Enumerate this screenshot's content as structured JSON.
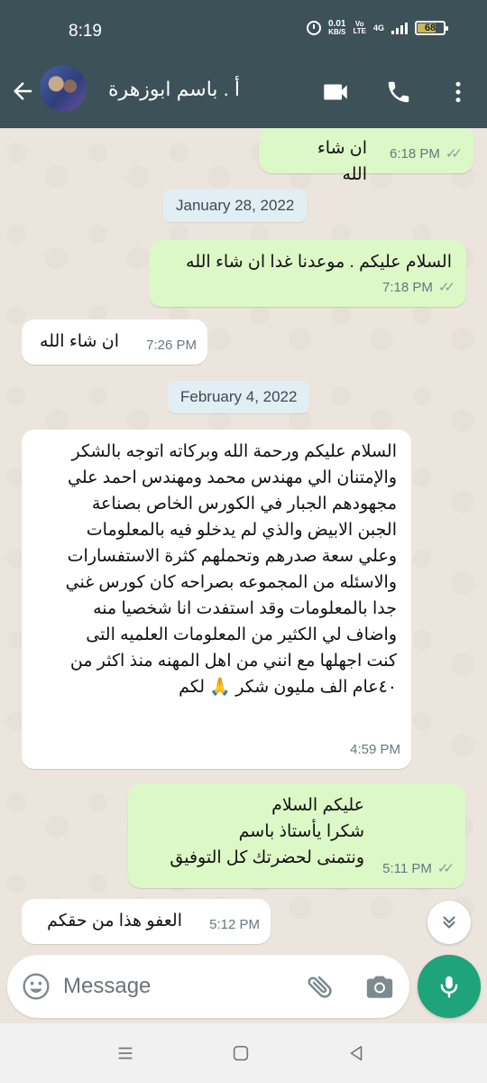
{
  "status_bar": {
    "time": "8:19",
    "speed_value": "0.01",
    "speed_unit": "KB/S",
    "volte_top": "Vo",
    "volte_bottom": "LTE",
    "network_type": "4G",
    "battery_level": "68"
  },
  "header": {
    "contact_name": "أ . باسم ابوزهرة",
    "bar_color": "#3d5159"
  },
  "messages": [
    {
      "direction": "out",
      "text": "ان شاء الله",
      "time": "6:18 PM",
      "read": true
    },
    {
      "type": "date",
      "text": "January 28, 2022"
    },
    {
      "direction": "out",
      "text": "السلام عليكم . موعدنا غدا ان شاء الله",
      "time": "7:18 PM",
      "read": true
    },
    {
      "direction": "in",
      "text": "ان شاء الله",
      "time": "7:26 PM"
    },
    {
      "type": "date",
      "text": "February 4, 2022"
    },
    {
      "direction": "in",
      "lines": [
        "السلام عليكم ورحمة الله وبركاته اتوجه بالشكر",
        "والإمتنان الي مهندس محمد ومهندس احمد علي",
        "مجهودهم الجبار في الكورس الخاص بصناعة",
        "الجبن الابيض والذي لم يدخلو فيه بالمعلومات",
        "وعلي سعة صدرهم وتحملهم كثرة الاستفسارات",
        "والاسئله من المجموعه بصراحه كان كورس غني",
        "جدا بالمعلومات وقد استفدت انا شخصيا منه",
        "واضاف لي الكثير من المعلومات العلميه التى",
        "كنت اجهلها مع انني من اهل المهنه منذ اكثر من",
        "٤٠عام الف مليون شكر 🙏 لكم"
      ],
      "time": "4:59 PM"
    },
    {
      "direction": "out",
      "lines": [
        "عليكم السلام",
        "شكرا يأستاذ باسم",
        "ونتمنى لحضرتك كل التوفيق"
      ],
      "time": "5:11 PM",
      "read": true
    },
    {
      "direction": "in",
      "text": "العفو هذا من حقكم",
      "time": "5:12 PM"
    }
  ],
  "input": {
    "placeholder": "Message"
  },
  "icons": {
    "back": "back-arrow-icon",
    "video": "video-call-icon",
    "voice": "voice-call-icon",
    "menu": "more-vertical-icon",
    "emoji": "emoji-icon",
    "attach": "paperclip-icon",
    "camera": "camera-icon",
    "mic": "microphone-icon",
    "scroll": "chevrons-down-icon"
  },
  "colors": {
    "outgoing_bubble": "#dcf8c6",
    "incoming_bubble": "#ffffff",
    "accent": "#1fa37a"
  }
}
